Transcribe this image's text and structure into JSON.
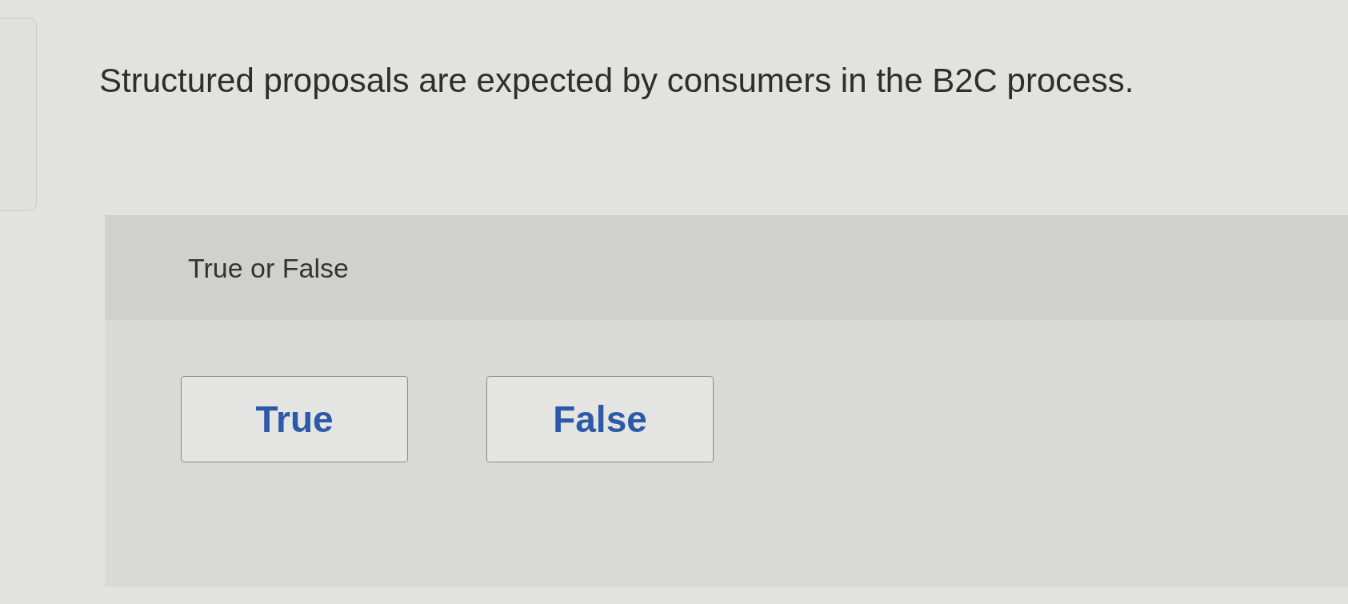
{
  "question": {
    "text": "Structured proposals are expected by consumers in the B2C process."
  },
  "answer_panel": {
    "prompt": "True or False",
    "options": [
      {
        "label": "True",
        "selected": false
      },
      {
        "label": "False",
        "selected": false
      }
    ]
  }
}
